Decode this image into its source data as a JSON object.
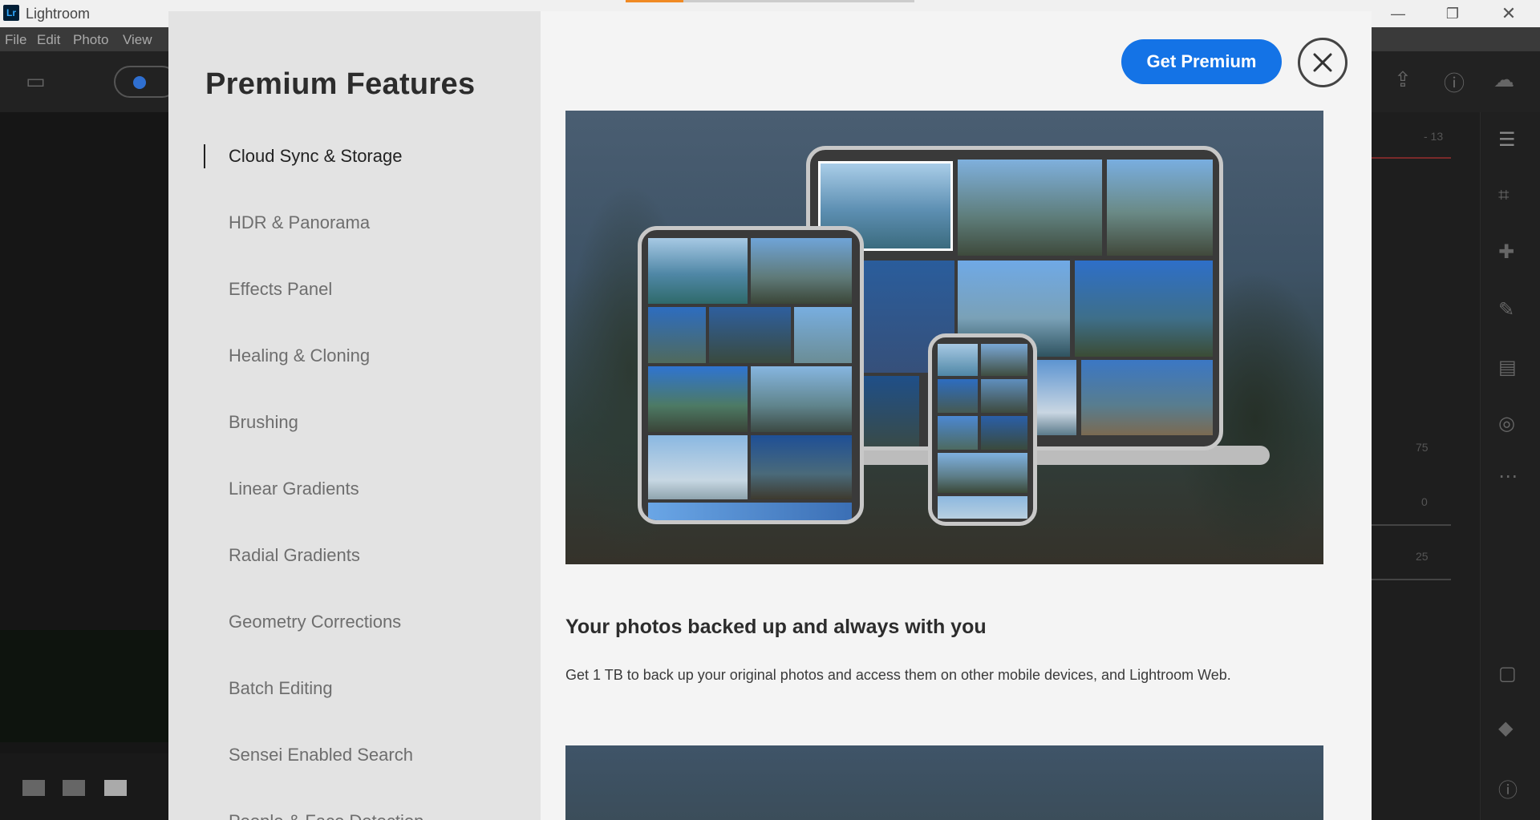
{
  "window": {
    "logo_text": "Lr",
    "title": "Lightroom",
    "minimize": "—",
    "restore": "❐",
    "close": "✕"
  },
  "menu": [
    "File",
    "Edit",
    "Photo",
    "View"
  ],
  "background": {
    "values": [
      "- 13",
      "75",
      "0",
      "25"
    ]
  },
  "modal": {
    "sidebar_title": "Premium Features",
    "nav_items": [
      "Cloud Sync & Storage",
      "HDR & Panorama",
      "Effects Panel",
      "Healing & Cloning",
      "Brushing",
      "Linear Gradients",
      "Radial Gradients",
      "Geometry Corrections",
      "Batch Editing",
      "Sensei Enabled Search",
      "People & Face Detection"
    ],
    "active_index": 0,
    "get_premium_label": "Get Premium",
    "section_title": "Your photos backed up and always with you",
    "section_desc": "Get 1 TB to back up your original photos and access them on other mobile devices, and Lightroom Web."
  },
  "colors": {
    "accent": "#1473e6",
    "sidebar_bg": "#e3e3e3",
    "content_bg": "#f4f4f4",
    "progress": "#f08a24"
  }
}
